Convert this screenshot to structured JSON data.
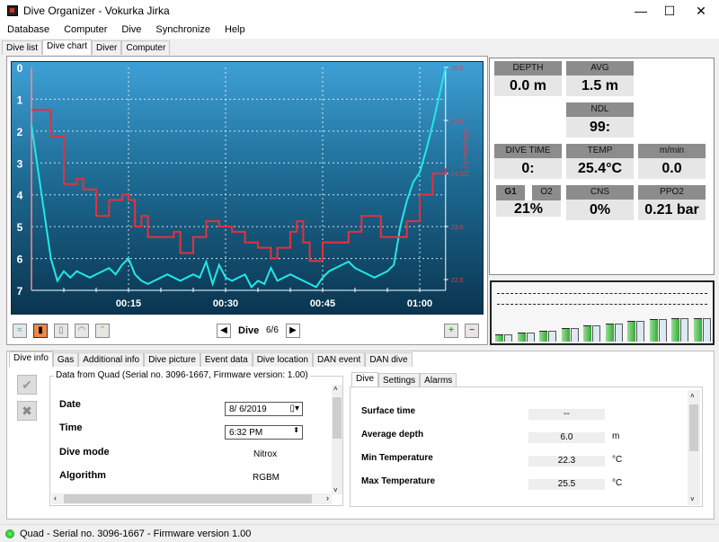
{
  "window": {
    "title": "Dive Organizer - Vokurka Jirka",
    "minimize": "—",
    "maximize": "☐",
    "close": "✕"
  },
  "menu": [
    "Database",
    "Computer",
    "Dive",
    "Synchronize",
    "Help"
  ],
  "main_tabs": [
    "Dive list",
    "Dive chart",
    "Diver",
    "Computer"
  ],
  "active_main_tab": "Dive chart",
  "chart_data": {
    "type": "line",
    "x_unit": "minutes",
    "x_ticks": [
      "00:15",
      "00:30",
      "00:45",
      "01:00"
    ],
    "y_left": {
      "ticks": [
        "0",
        "1",
        "2",
        "3",
        "4",
        "5",
        "6",
        "7"
      ],
      "range": [
        7,
        0
      ],
      "label": ""
    },
    "y_right": {
      "ticks": [
        "26.0",
        "25.0",
        "24.0",
        "23.0",
        "22.0"
      ],
      "range": [
        22,
        26
      ],
      "label": "Temperature [°C]"
    },
    "grid": true,
    "series": [
      {
        "id": "depth",
        "color": "#22e8e8",
        "axis": "left",
        "x": [
          0,
          1,
          2,
          3,
          4,
          5,
          6,
          7,
          8,
          9,
          10,
          11,
          12,
          13,
          14,
          15,
          16,
          17,
          18,
          19,
          20,
          21,
          22,
          23,
          24,
          25,
          26,
          27,
          28,
          29,
          30,
          31,
          32,
          33,
          34,
          35,
          36,
          37,
          38,
          39,
          40,
          41,
          42,
          43,
          44,
          45,
          46,
          47,
          48,
          49,
          50,
          51,
          52,
          53,
          54,
          55,
          56,
          57,
          58,
          59,
          60,
          61,
          62,
          63,
          64
        ],
        "values": [
          1.8,
          3.2,
          4.6,
          6.0,
          6.7,
          6.4,
          6.6,
          6.4,
          6.5,
          6.6,
          6.5,
          6.4,
          6.3,
          6.5,
          6.2,
          6.0,
          6.5,
          6.7,
          6.8,
          6.7,
          6.6,
          6.5,
          6.6,
          6.7,
          6.6,
          6.5,
          6.6,
          6.1,
          6.8,
          6.2,
          6.6,
          6.7,
          6.6,
          6.5,
          6.9,
          6.7,
          6.8,
          6.3,
          6.7,
          6.6,
          6.5,
          6.6,
          6.7,
          6.8,
          6.9,
          6.6,
          6.4,
          6.3,
          6.2,
          6.1,
          6.3,
          6.4,
          6.5,
          6.6,
          6.5,
          6.4,
          6.2,
          5.0,
          4.2,
          3.6,
          3.3,
          2.6,
          1.8,
          0.9,
          0.0
        ]
      },
      {
        "id": "temperature",
        "color": "#e8303a",
        "axis": "right",
        "x": [
          0,
          3,
          5,
          7,
          8,
          10,
          12,
          14,
          15,
          16,
          17,
          18,
          20,
          22,
          23,
          25,
          27,
          29,
          31,
          33,
          35,
          37,
          38,
          40,
          41,
          42,
          43,
          45,
          47,
          49,
          51,
          53,
          54,
          56,
          58,
          60,
          62,
          64
        ],
        "values": [
          25.2,
          24.7,
          23.8,
          23.9,
          23.7,
          23.2,
          23.5,
          23.6,
          23.5,
          23.0,
          23.2,
          22.8,
          22.8,
          22.9,
          22.5,
          22.8,
          23.1,
          23.0,
          22.9,
          22.7,
          22.6,
          22.4,
          22.6,
          22.9,
          23.1,
          22.7,
          22.35,
          22.7,
          22.7,
          22.9,
          23.2,
          23.2,
          22.8,
          22.8,
          23.1,
          23.6,
          24.0,
          24.1
        ]
      }
    ]
  },
  "chart_toolbar": {
    "dive_label": "Dive",
    "dive_counter": "6/6",
    "zoom_in": "+",
    "zoom_out": "−"
  },
  "indicators": {
    "depth": {
      "label": "DEPTH",
      "value": "0.0 m"
    },
    "avg": {
      "label": "AVG",
      "value": "1.5 m"
    },
    "ndl": {
      "label": "NDL",
      "value": "99:"
    },
    "dive_time": {
      "label": "DIVE TIME",
      "value": "0:"
    },
    "temp": {
      "label": "TEMP",
      "value": "25.4°C"
    },
    "rate": {
      "label": "m/min",
      "value": "0.0"
    },
    "gas": {
      "label": "G1",
      "label2": "O2",
      "value": "21%"
    },
    "cns": {
      "label": "CNS",
      "value": "0%"
    },
    "ppo2": {
      "label": "PPO2",
      "value": "0.21 bar"
    }
  },
  "tissue_bars": [
    0.25,
    0.33,
    0.4,
    0.5,
    0.6,
    0.67,
    0.77,
    0.82,
    0.85,
    0.88
  ],
  "info_tabs": [
    "Dive info",
    "Gas",
    "Additional info",
    "Dive picture",
    "Event data",
    "Dive location",
    "DAN event",
    "DAN dive"
  ],
  "dive_info": {
    "group_title": "Data from Quad (Serial no. 3096-1667, Firmware version: 1.00)",
    "date_label": "Date",
    "date_value": "8/  6/2019",
    "time_label": "Time",
    "time_value": "6:32 PM",
    "mode_label": "Dive mode",
    "mode_value": "Nitrox",
    "algo_label": "Algorithm",
    "algo_value": "RGBM"
  },
  "detail_tabs": [
    "Dive",
    "Settings",
    "Alarms"
  ],
  "dive_details": [
    {
      "label": "Surface time",
      "value": "--",
      "unit": ""
    },
    {
      "label": "Average depth",
      "value": "6.0",
      "unit": "m"
    },
    {
      "label": "Min Temperature",
      "value": "22.3",
      "unit": "°C"
    },
    {
      "label": "Max Temperature",
      "value": "25.5",
      "unit": "°C"
    }
  ],
  "status": {
    "text": "Quad - Serial no. 3096-1667 - Firmware version 1.00"
  }
}
